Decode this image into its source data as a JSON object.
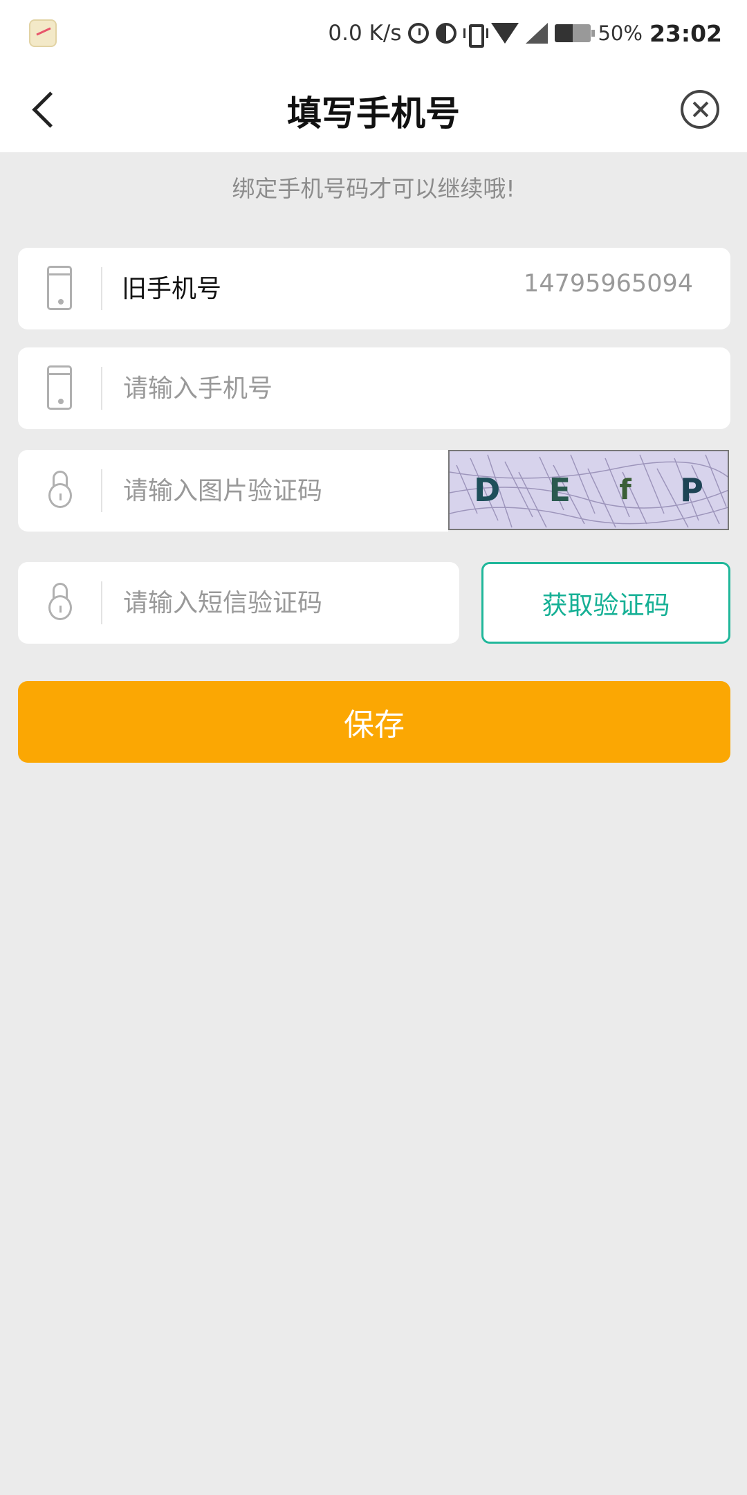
{
  "status_bar": {
    "speed": "0.0 K/s",
    "battery_pct": "50%",
    "time": "23:02"
  },
  "nav": {
    "title": "填写手机号"
  },
  "hint": "绑定手机号码才可以继续哦!",
  "old_phone": {
    "label": "旧手机号",
    "value": "14795965094"
  },
  "new_phone": {
    "placeholder": "请输入手机号"
  },
  "image_code": {
    "placeholder": "请输入图片验证码",
    "captcha_chars": [
      "D",
      "E",
      "f",
      "P"
    ]
  },
  "sms_code": {
    "placeholder": "请输入短信验证码",
    "button_label": "获取验证码"
  },
  "save_label": "保存",
  "colors": {
    "accent": "#fba703",
    "teal": "#16b095",
    "background": "#ebebeb"
  }
}
